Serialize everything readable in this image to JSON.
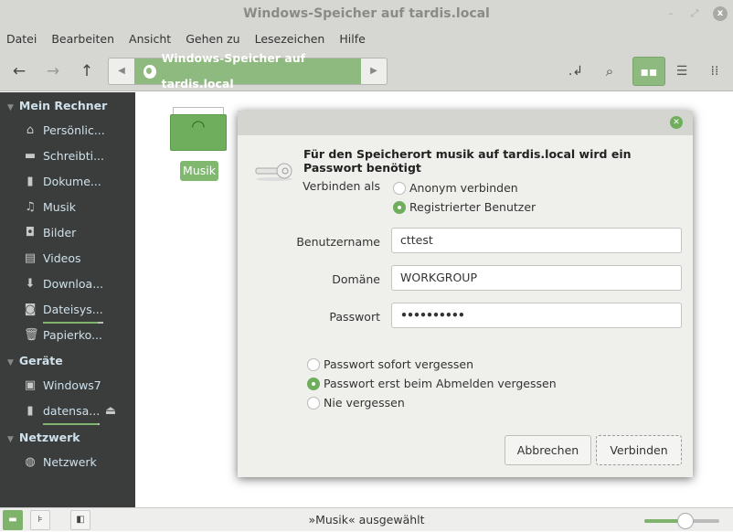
{
  "window": {
    "title": "Windows-Speicher auf tardis.local"
  },
  "menu": [
    "Datei",
    "Bearbeiten",
    "Ansicht",
    "Gehen zu",
    "Lesezeichen",
    "Hilfe"
  ],
  "pathbar": {
    "current": "Windows-Speicher auf tardis.local"
  },
  "sidebar": {
    "sections": [
      {
        "title": "Mein Rechner",
        "items": [
          {
            "label": "Persönlic...",
            "icon": "home-icon"
          },
          {
            "label": "Schreibti...",
            "icon": "desktop-icon"
          },
          {
            "label": "Dokume...",
            "icon": "document-icon"
          },
          {
            "label": "Musik",
            "icon": "music-icon"
          },
          {
            "label": "Bilder",
            "icon": "camera-icon"
          },
          {
            "label": "Videos",
            "icon": "film-icon"
          },
          {
            "label": "Downloa...",
            "icon": "download-icon"
          },
          {
            "label": "Dateisys...",
            "icon": "harddisk-icon"
          },
          {
            "label": "Papierko...",
            "icon": "trash-icon"
          }
        ]
      },
      {
        "title": "Geräte",
        "items": [
          {
            "label": "Windows7",
            "icon": "drive-icon"
          },
          {
            "label": "datensa...",
            "icon": "usb-icon"
          }
        ]
      },
      {
        "title": "Netzwerk",
        "items": [
          {
            "label": "Netzwerk",
            "icon": "globe-icon"
          }
        ]
      }
    ]
  },
  "content": {
    "folder_label": "Musik"
  },
  "dialog": {
    "message": "Für den Speicherort musik auf tardis.local wird ein Passwort benötigt",
    "connect_as_label": "Verbinden als",
    "connect_options": [
      {
        "label": "Anonym verbinden",
        "selected": false
      },
      {
        "label": "Registrierter Benutzer",
        "selected": true
      }
    ],
    "username_label": "Benutzername",
    "username": "cttest",
    "domain_label": "Domäne",
    "domain": "WORKGROUP",
    "password_label": "Passwort",
    "password": "••••••••••",
    "remember_options": [
      {
        "label": "Passwort sofort vergessen",
        "selected": false
      },
      {
        "label": "Passwort erst beim Abmelden vergessen",
        "selected": true
      },
      {
        "label": "Nie vergessen",
        "selected": false
      }
    ],
    "cancel": "Abbrechen",
    "connect": "Verbinden"
  },
  "statusbar": {
    "text": "»Musik« ausgewählt",
    "zoom_percent": 55
  },
  "colors": {
    "accent": "#8fba7f",
    "sidebar": "#3b3d3c"
  }
}
